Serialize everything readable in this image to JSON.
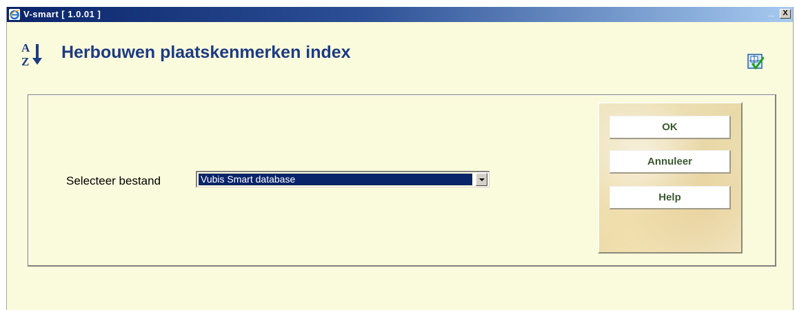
{
  "window": {
    "title": "V-smart [ 1.0.01 ]",
    "title_extra": "...",
    "close_label": "X"
  },
  "page": {
    "title": "Herbouwen plaatskenmerken index",
    "sort_icon_letters": [
      "A",
      "Z"
    ]
  },
  "form": {
    "select_label": "Selecteer bestand",
    "select_value": "Vubis Smart database"
  },
  "buttons": {
    "ok": "OK",
    "cancel": "Annuleer",
    "help": "Help"
  },
  "colors": {
    "background": "#fafadc",
    "title_blue": "#1d3b83",
    "titlebar_start": "#0a246a",
    "titlebar_end": "#a6caf0",
    "button_text": "#3a5a30",
    "selected_bg": "#0a246a"
  },
  "icons": {
    "app": "ie-icon",
    "sort": "sort-az-icon",
    "corner": "document-check-icon",
    "dropdown": "chevron-down-icon"
  }
}
